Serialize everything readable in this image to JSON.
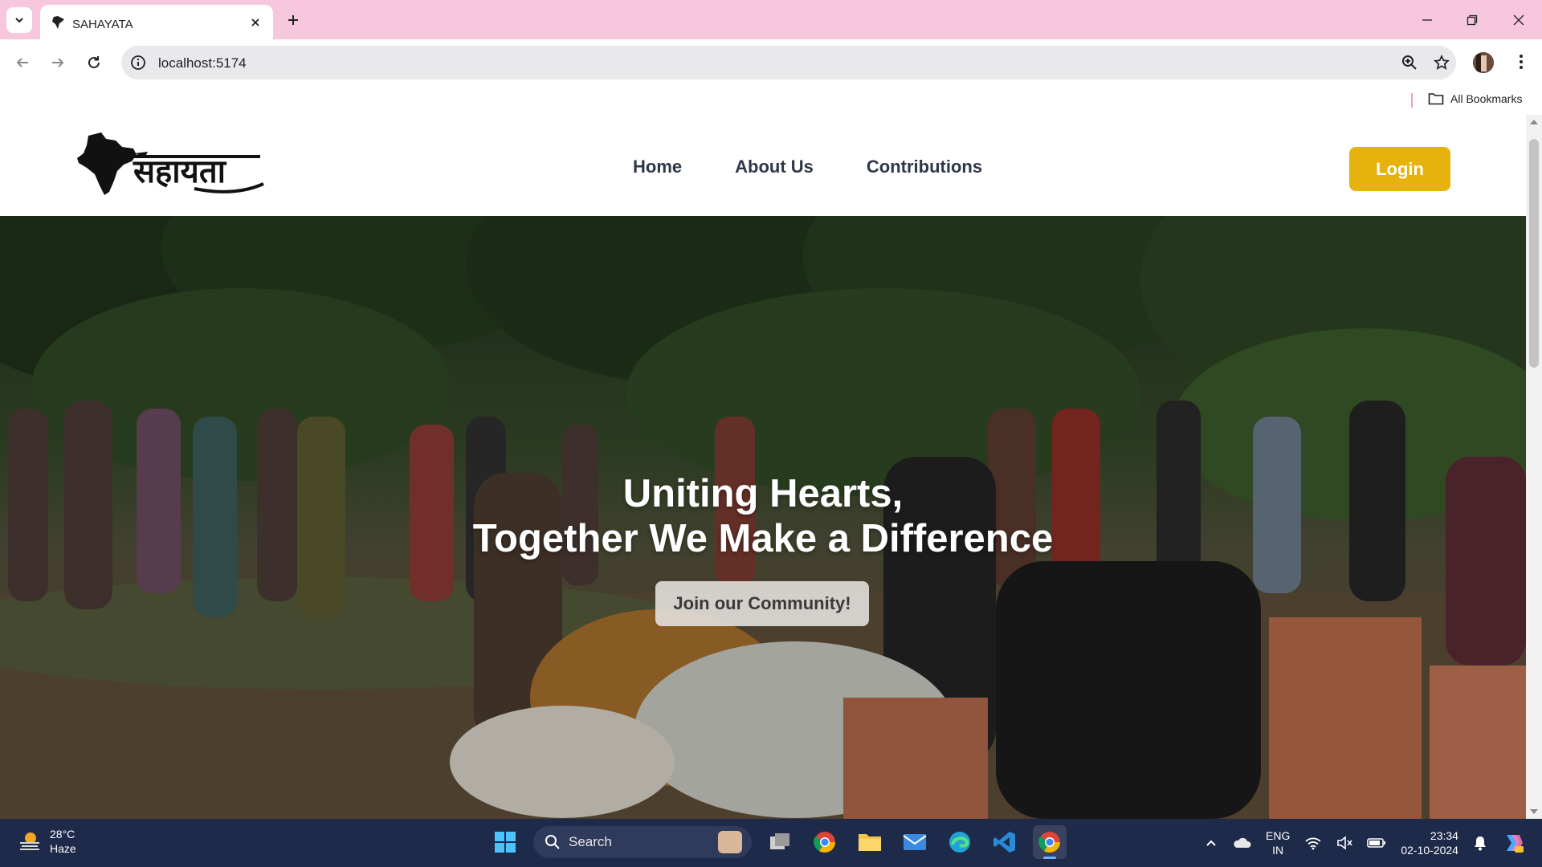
{
  "browser": {
    "tab_title": "SAHAYATA",
    "url": "localhost:5174",
    "bookmarks_label": "All Bookmarks"
  },
  "site": {
    "logo_text": "सहायता",
    "nav": [
      {
        "label": "Home"
      },
      {
        "label": "About Us"
      },
      {
        "label": "Contributions"
      }
    ],
    "login_label": "Login"
  },
  "hero": {
    "title_line1": "Uniting Hearts,",
    "title_line2": "Together We Make a Difference",
    "cta_label": "Join our Community!"
  },
  "taskbar": {
    "weather_temp": "28°C",
    "weather_cond": "Haze",
    "search_label": "Search",
    "lang_line1": "ENG",
    "lang_line2": "IN",
    "time": "23:34",
    "date": "02-10-2024"
  },
  "colors": {
    "tabbar_bg": "#f7c7de",
    "login_bg": "#e8b20e",
    "chat_bg": "#f6c90e",
    "taskbar_bg": "#1e2a4a"
  }
}
